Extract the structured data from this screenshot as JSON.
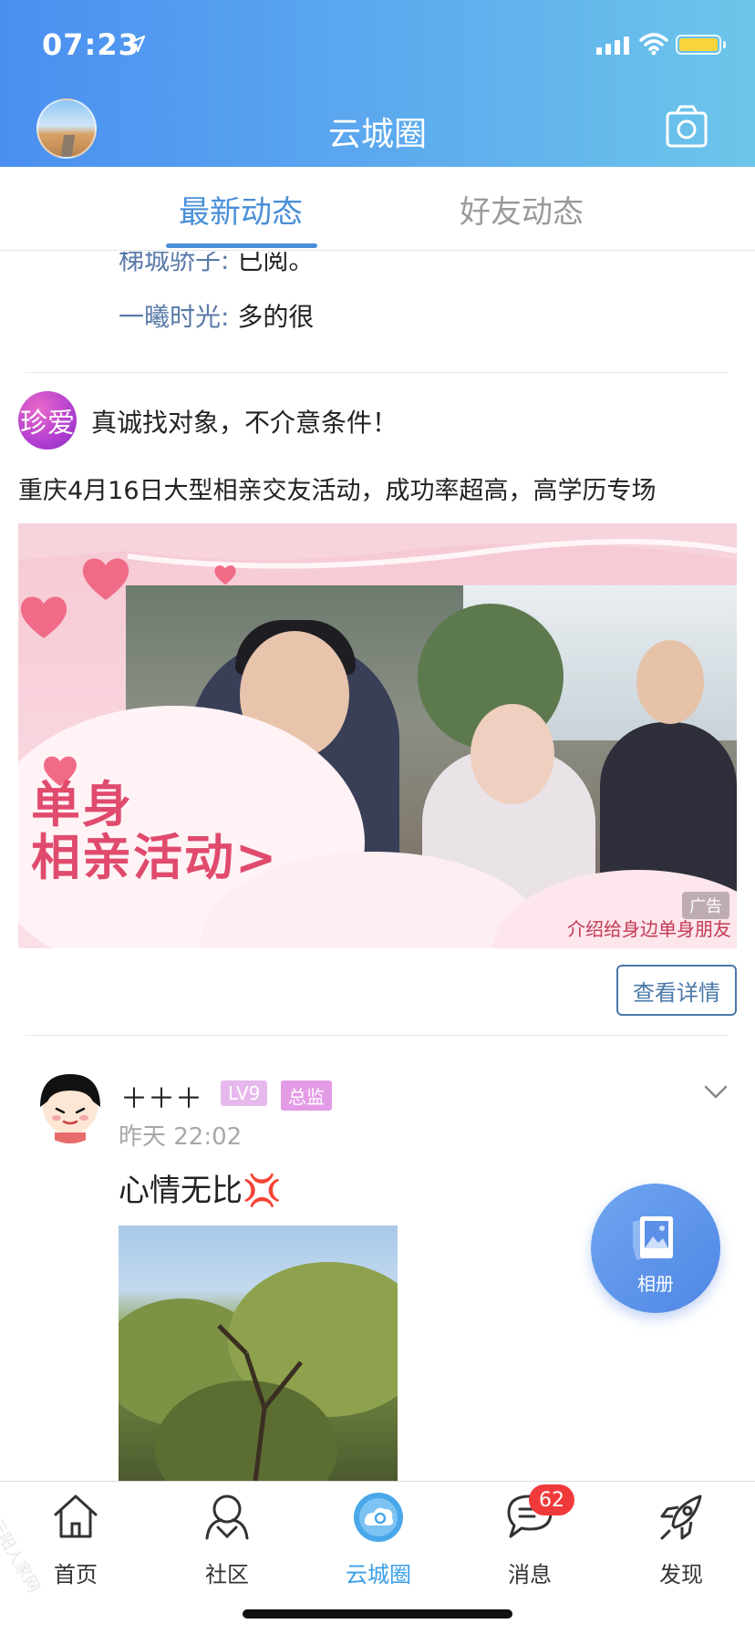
{
  "status_bar": {
    "time": "07:23"
  },
  "header": {
    "title": "云城圈"
  },
  "tabs": [
    {
      "label": "最新动态",
      "active": true
    },
    {
      "label": "好友动态",
      "active": false
    }
  ],
  "comments": [
    {
      "name": "梯城骄子:",
      "text": "已阅。"
    },
    {
      "name": "一曦时光:",
      "text": "多的很"
    }
  ],
  "ad_post": {
    "avatar_text": "珍爱",
    "title": "真诚找对象，不介意条件！",
    "description": "重庆4月16日大型相亲交友活动，成功率超高，高学历专场",
    "banner_headline_1": "单身",
    "banner_headline_2": "相亲活动>",
    "banner_caption": "介绍给身边单身朋友",
    "ad_badge": "广告",
    "detail_button": "查看详情"
  },
  "user_post": {
    "name": "＋＋＋",
    "level": "LV9",
    "role": "总监",
    "time": "昨天 22:02",
    "text": "心情无比💢"
  },
  "album_fab": {
    "label": "相册"
  },
  "bottom_nav": [
    {
      "label": "首页",
      "icon": "home-icon"
    },
    {
      "label": "社区",
      "icon": "community-icon"
    },
    {
      "label": "云城圈",
      "icon": "cloud-circle-icon",
      "active": true
    },
    {
      "label": "消息",
      "icon": "message-icon",
      "badge": "62"
    },
    {
      "label": "发现",
      "icon": "rocket-icon"
    }
  ],
  "watermark": "云阳人家网",
  "colors": {
    "accent": "#4a8fd8",
    "header_start": "#4a8ff0",
    "header_end": "#6cc6ea",
    "badge": "#f03a3a",
    "nav_active": "#3aa0e6"
  }
}
